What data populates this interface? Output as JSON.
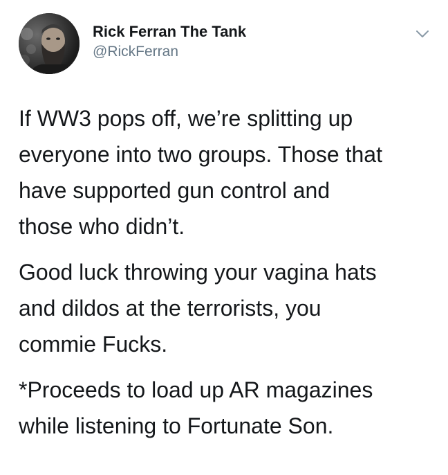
{
  "author": {
    "display_name": "Rick Ferran The Tank",
    "handle": "@RickFerran",
    "avatar_icon": "profile-photo"
  },
  "menu": {
    "icon": "chevron-down-icon"
  },
  "tweet": {
    "paragraphs": [
      {
        "lines": [
          "If WW3 pops off, we’re splitting up",
          "everyone into two groups. Those that",
          "have supported gun control and",
          "those who didn’t."
        ]
      },
      {
        "lines": [
          "Good luck throwing your vagina hats",
          "and dildos at the terrorists, you",
          "commie Fucks."
        ]
      },
      {
        "lines": [
          "*Proceeds to load up AR magazines",
          "while listening to Fortunate Son."
        ]
      }
    ]
  },
  "colors": {
    "text": "#14171a",
    "secondary_text": "#657786",
    "chevron": "#8899a6",
    "background": "#ffffff"
  }
}
